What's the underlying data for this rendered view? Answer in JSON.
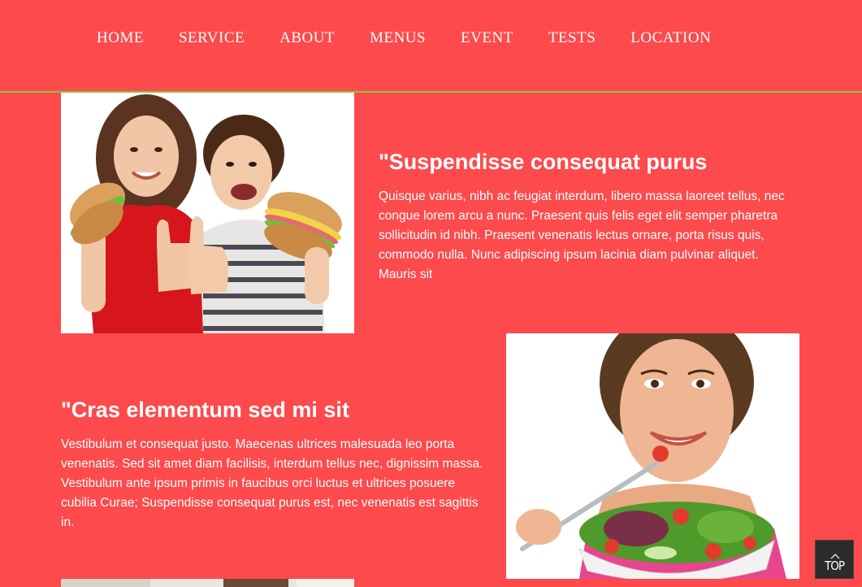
{
  "nav": {
    "items": [
      {
        "label": "HOME"
      },
      {
        "label": "SERVICE"
      },
      {
        "label": "ABOUT"
      },
      {
        "label": "MENUS"
      },
      {
        "label": "EVENT"
      },
      {
        "label": "TESTS"
      },
      {
        "label": "LOCATION"
      }
    ]
  },
  "sections": [
    {
      "title": "\"Suspendisse consequat purus",
      "body": "Quisque varius, nibh ac feugiat interdum, libero massa laoreet tellus, nec congue lorem arcu a nunc. Praesent quis felis eget elit semper pharetra sollicitudin id nibh. Praesent venenatis lectus ornare, porta risus quis, commodo nulla. Nunc adipiscing ipsum lacinia diam pulvinar aliquet. Mauris sit"
    },
    {
      "title": "\"Cras elementum sed mi sit",
      "body": "Vestibulum et consequat justo. Maecenas ultrices malesuada leo porta venenatis. Sed sit amet diam facilisis, interdum tellus nec, dignissim massa. Vestibulum ante ipsum primis in faucibus orci luctus et ultrices posuere cubilia Curae; Suspendisse consequat purus est, nec venenatis est sagittis in."
    }
  ],
  "back_to_top": {
    "label": "TOP",
    "icon": "chevron-up-icon"
  },
  "colors": {
    "background": "#fd4a4c",
    "nav_border": "#8cc63f",
    "text": "#ffffff",
    "top_button": "#2b2b2b"
  }
}
